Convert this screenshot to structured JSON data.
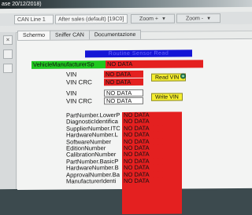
{
  "window": {
    "title": "ase 20/12/2018)"
  },
  "toolbar": {
    "channel_select": "CAN Line 1",
    "profile_select": "After sales (default) [19C0]",
    "zoom_in_label": "Zoom +",
    "zoom_out_label": "Zoom -"
  },
  "tabs": [
    {
      "label": "Schermo",
      "active": true
    },
    {
      "label": "Sniffer CAN",
      "active": false
    },
    {
      "label": "Documentazione",
      "active": false
    }
  ],
  "panel": {
    "title": "Routine Sensor Read",
    "vehicle_manufacturer_label": "VehicleManufacturerSp",
    "vehicle_manufacturer_value": "NO DATA",
    "read_vin": {
      "vin_label": "VIN",
      "vin_value": "NO DATA",
      "crc_label": "VIN  CRC",
      "crc_value": "NO DATA",
      "button_label": "Read VIN"
    },
    "write_vin": {
      "vin_label": "VIN",
      "vin_value": "NO DATA",
      "crc_label": "VIN  CRC",
      "crc_value": "NO DATA",
      "button_label": "Write VIN"
    },
    "identifiers": [
      {
        "label": "PartNumber.LowerP",
        "value": "NO DATA"
      },
      {
        "label": "DiagnosticIdentifica",
        "value": "NO DATA"
      },
      {
        "label": "SupplierNumber.ITC",
        "value": "NO DATA"
      },
      {
        "label": "HardwareNumber.L",
        "value": "NO DATA"
      },
      {
        "label": "SoftwareNumber",
        "value": "NO DATA"
      },
      {
        "label": "EditionNumber",
        "value": "NO DATA"
      },
      {
        "label": "CalibrationNumber",
        "value": "NO DATA"
      },
      {
        "label": "PartNumber.BasicP",
        "value": "NO DATA"
      },
      {
        "label": "HardwareNumber.B",
        "value": "NO DATA"
      },
      {
        "label": "ApprovalNumber.Ba",
        "value": "NO DATA"
      },
      {
        "label": "ManufacturerIdenti",
        "value": "NO DATA"
      }
    ]
  },
  "colors": {
    "status_no_data": "#e42020",
    "manufacturer_label_bg": "#1fc81f",
    "title_bar_bg": "#1515d6",
    "button_bg": "#f5ee2e"
  },
  "icons": [
    "close-icon",
    "gear-icon",
    "cursor-icon",
    "chevron-down-icon"
  ]
}
